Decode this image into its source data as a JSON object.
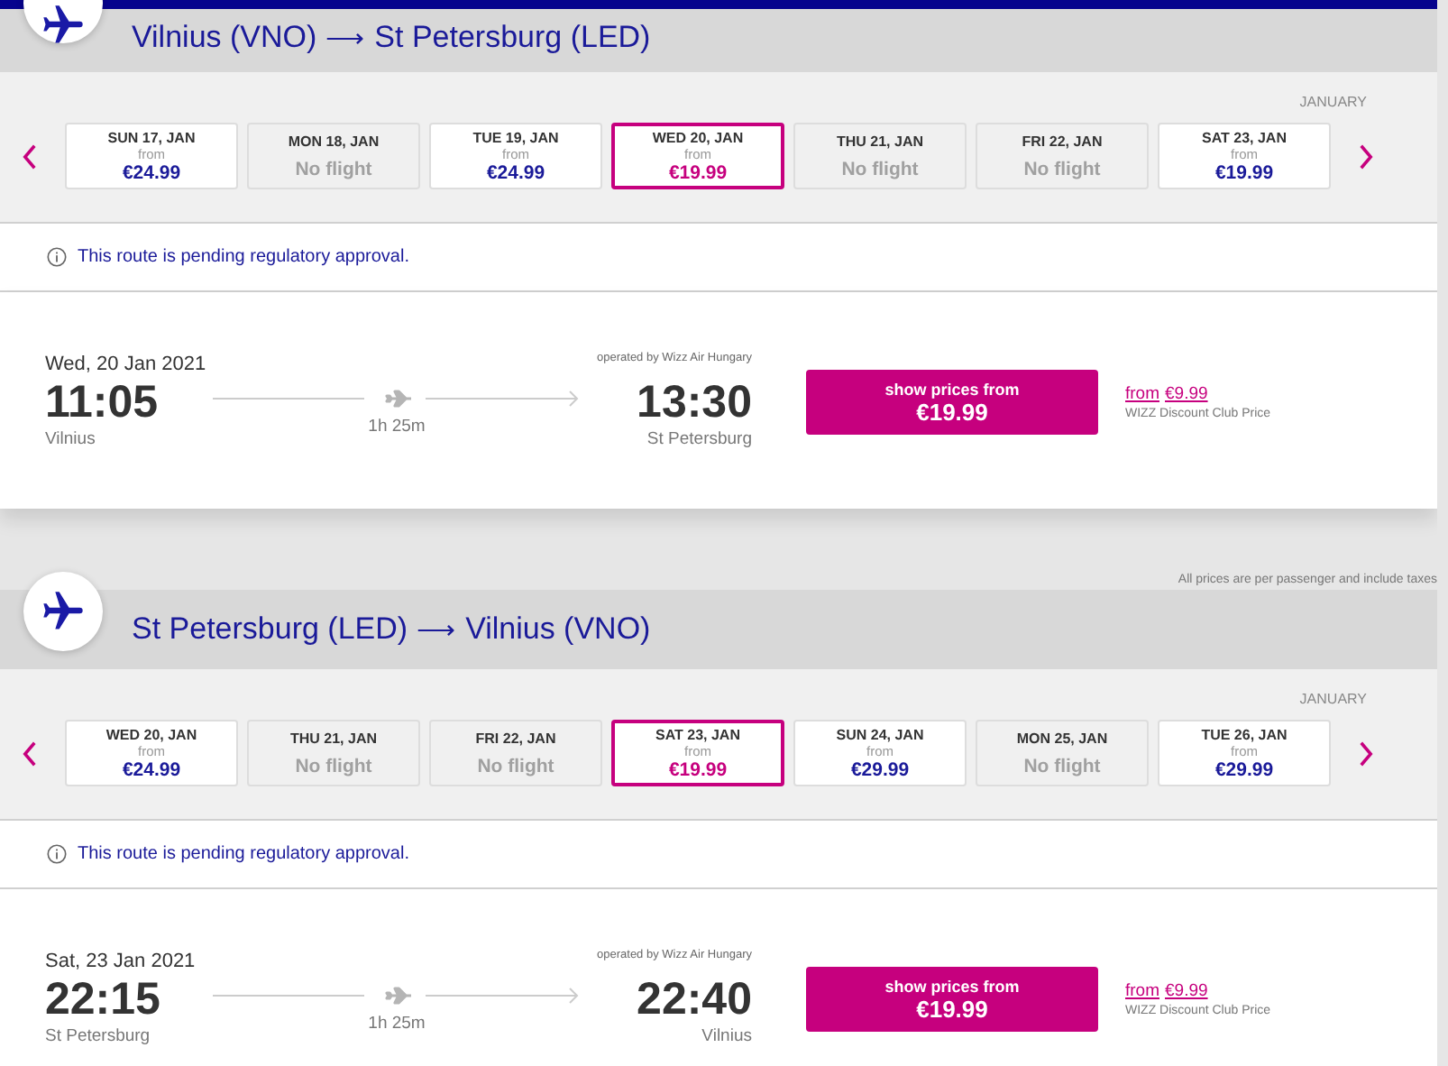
{
  "routes": [
    {
      "from": "Vilnius (VNO)",
      "arrow": "⟶",
      "to": "St Petersburg (LED)",
      "month": "JANUARY",
      "days": [
        {
          "label": "SUN 17, JAN",
          "from": "from",
          "price": "€24.99",
          "available": true,
          "selected": false
        },
        {
          "label": "MON 18, JAN",
          "price": "No flight",
          "available": false,
          "selected": false
        },
        {
          "label": "TUE 19, JAN",
          "from": "from",
          "price": "€24.99",
          "available": true,
          "selected": false
        },
        {
          "label": "WED 20, JAN",
          "from": "from",
          "price": "€19.99",
          "available": true,
          "selected": true
        },
        {
          "label": "THU 21, JAN",
          "price": "No flight",
          "available": false,
          "selected": false
        },
        {
          "label": "FRI 22, JAN",
          "price": "No flight",
          "available": false,
          "selected": false
        },
        {
          "label": "SAT 23, JAN",
          "from": "from",
          "price": "€19.99",
          "available": true,
          "selected": false
        }
      ],
      "notice": "This route is pending regulatory approval.",
      "flight": {
        "date": "Wed, 20 Jan 2021",
        "depart": "11:05",
        "depart_city": "Vilnius",
        "duration": "1h 25m",
        "operator": "operated by Wizz Air Hungary",
        "arrive": "13:30",
        "arrive_city": "St Petersburg",
        "button_label": "show prices from",
        "button_price": "€19.99",
        "club_from": "from",
        "club_price": "€9.99",
        "club_label": "WIZZ Discount Club Price"
      }
    },
    {
      "from": "St Petersburg (LED)",
      "arrow": "⟶",
      "to": "Vilnius (VNO)",
      "month": "JANUARY",
      "days": [
        {
          "label": "WED 20, JAN",
          "from": "from",
          "price": "€24.99",
          "available": true,
          "selected": false
        },
        {
          "label": "THU 21, JAN",
          "price": "No flight",
          "available": false,
          "selected": false
        },
        {
          "label": "FRI 22, JAN",
          "price": "No flight",
          "available": false,
          "selected": false
        },
        {
          "label": "SAT 23, JAN",
          "from": "from",
          "price": "€19.99",
          "available": true,
          "selected": true
        },
        {
          "label": "SUN 24, JAN",
          "from": "from",
          "price": "€29.99",
          "available": true,
          "selected": false
        },
        {
          "label": "MON 25, JAN",
          "price": "No flight",
          "available": false,
          "selected": false
        },
        {
          "label": "TUE 26, JAN",
          "from": "from",
          "price": "€29.99",
          "available": true,
          "selected": false
        }
      ],
      "notice": "This route is pending regulatory approval.",
      "flight": {
        "date": "Sat, 23 Jan 2021",
        "depart": "22:15",
        "depart_city": "St Petersburg",
        "duration": "1h 25m",
        "operator": "operated by Wizz Air Hungary",
        "arrive": "22:40",
        "arrive_city": "Vilnius",
        "button_label": "show prices from",
        "button_price": "€19.99",
        "club_from": "from",
        "club_price": "€9.99",
        "club_label": "WIZZ Discount Club Price"
      }
    }
  ],
  "footnote": "All prices are per passenger and include taxes"
}
